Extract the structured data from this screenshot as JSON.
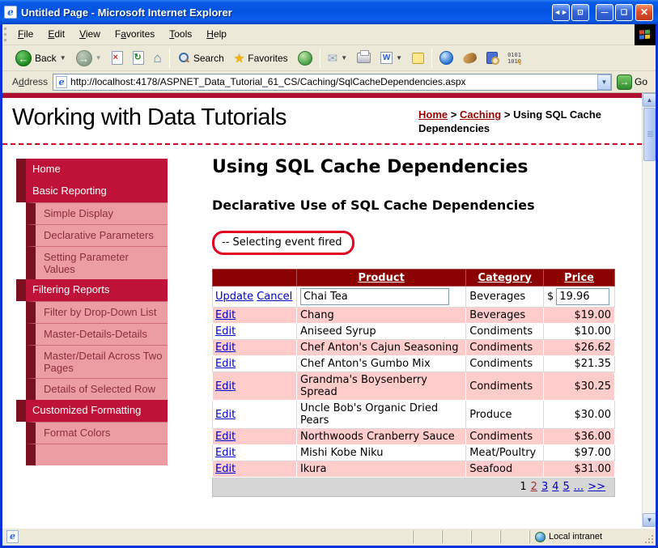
{
  "colors": {
    "window_border": "#0831d9",
    "accent_bar": "#b01030",
    "nav_item_bg": "#be1238",
    "nav_tab": "#7a1022",
    "nav_sub_bg": "#ec9da4",
    "nav_sub_text": "#8b2e3c",
    "grid_header_bg": "#8b0000",
    "grid_alt_row": "#ffcccc",
    "pager_bg": "#d6d6d6",
    "link_blue": "#0000cc",
    "visited_page_link": "#a03033",
    "breadcrumb_link": "#990000",
    "annotation_red": "#e00020"
  },
  "window": {
    "title": "Untitled Page - Microsoft Internet Explorer"
  },
  "menu": {
    "items": [
      {
        "label": "File",
        "accel": 0
      },
      {
        "label": "Edit",
        "accel": 0
      },
      {
        "label": "View",
        "accel": 0
      },
      {
        "label": "Favorites",
        "accel": 1
      },
      {
        "label": "Tools",
        "accel": 0
      },
      {
        "label": "Help",
        "accel": 0
      }
    ]
  },
  "toolbar": {
    "back_label": "Back",
    "search_label": "Search",
    "favorites_label": "Favorites"
  },
  "address": {
    "label": "Address",
    "accel": 1,
    "url": "http://localhost:4178/ASPNET_Data_Tutorial_61_CS/Caching/SqlCacheDependencies.aspx",
    "go_label": "Go"
  },
  "page": {
    "site_title": "Working with Data Tutorials",
    "breadcrumb": [
      {
        "label": "Home",
        "link": true
      },
      {
        "label": "Caching",
        "link": true
      },
      {
        "label": "Using SQL Cache Dependencies",
        "link": false
      }
    ],
    "sidebar": [
      {
        "label": "Home",
        "level": 1
      },
      {
        "label": "Basic Reporting",
        "level": 1
      },
      {
        "label": "Simple Display",
        "level": 2
      },
      {
        "label": "Declarative Parameters",
        "level": 2
      },
      {
        "label": "Setting Parameter Values",
        "level": 2
      },
      {
        "label": "Filtering Reports",
        "level": 1
      },
      {
        "label": "Filter by Drop-Down List",
        "level": 2
      },
      {
        "label": "Master-Details-Details",
        "level": 2
      },
      {
        "label": "Master/Detail Across Two Pages",
        "level": 2
      },
      {
        "label": "Details of Selected Row",
        "level": 2
      },
      {
        "label": "Customized Formatting",
        "level": 1
      },
      {
        "label": "Format Colors",
        "level": 2
      }
    ],
    "heading": "Using SQL Cache Dependencies",
    "subheading": "Declarative Use of SQL Cache Dependencies",
    "status_message": "-- Selecting event fired",
    "grid": {
      "columns": [
        "",
        "Product",
        "Category",
        "Price"
      ],
      "edit_row": {
        "update_label": "Update",
        "cancel_label": "Cancel",
        "product_value": "Chai Tea",
        "category": "Beverages",
        "currency": "$",
        "price_value": "19.96"
      },
      "rows": [
        {
          "action": "Edit",
          "product": "Chang",
          "category": "Beverages",
          "price": "$19.00"
        },
        {
          "action": "Edit",
          "product": "Aniseed Syrup",
          "category": "Condiments",
          "price": "$10.00"
        },
        {
          "action": "Edit",
          "product": "Chef Anton's Cajun Seasoning",
          "category": "Condiments",
          "price": "$26.62"
        },
        {
          "action": "Edit",
          "product": "Chef Anton's Gumbo Mix",
          "category": "Condiments",
          "price": "$21.35"
        },
        {
          "action": "Edit",
          "product": "Grandma's Boysenberry Spread",
          "category": "Condiments",
          "price": "$30.25"
        },
        {
          "action": "Edit",
          "product": "Uncle Bob's Organic Dried Pears",
          "category": "Produce",
          "price": "$30.00"
        },
        {
          "action": "Edit",
          "product": "Northwoods Cranberry Sauce",
          "category": "Condiments",
          "price": "$36.00"
        },
        {
          "action": "Edit",
          "product": "Mishi Kobe Niku",
          "category": "Meat/Poultry",
          "price": "$97.00"
        },
        {
          "action": "Edit",
          "product": "Ikura",
          "category": "Seafood",
          "price": "$31.00"
        }
      ],
      "pager": {
        "current": "1",
        "links": [
          {
            "label": "2",
            "visited": true
          },
          {
            "label": "3",
            "visited": false
          },
          {
            "label": "4",
            "visited": false
          },
          {
            "label": "5",
            "visited": false
          },
          {
            "label": "...",
            "visited": false
          },
          {
            "label": ">>",
            "visited": false
          }
        ]
      }
    }
  },
  "statusbar": {
    "zone_label": "Local intranet"
  }
}
